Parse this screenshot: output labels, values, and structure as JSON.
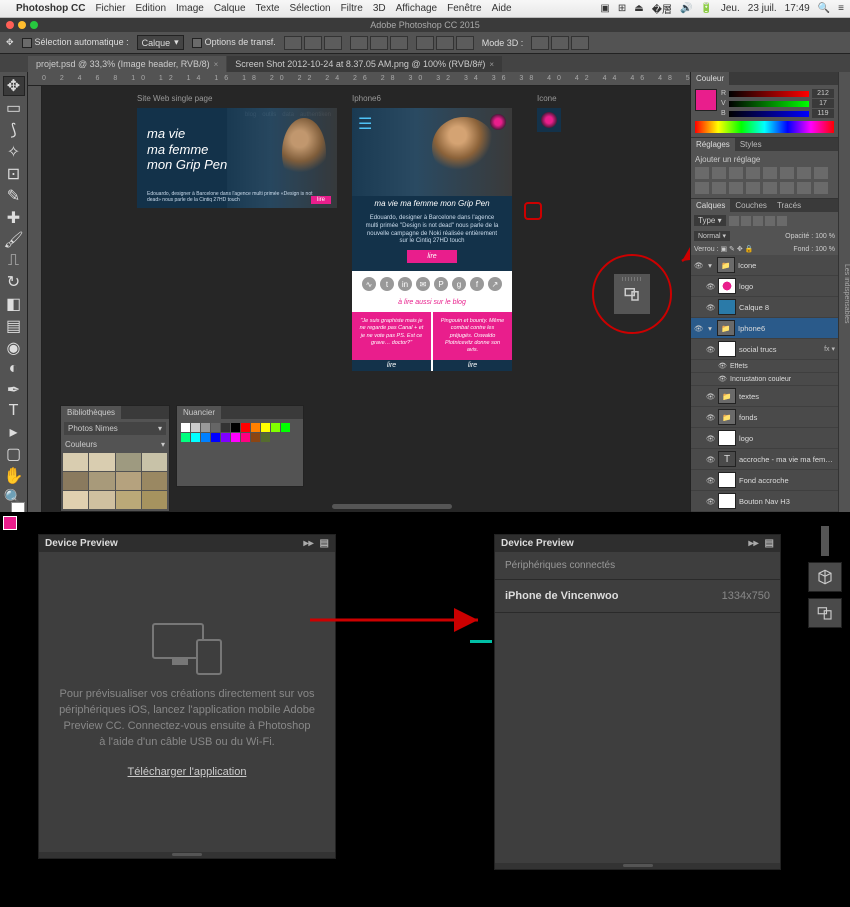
{
  "mac_menu": {
    "app": "Photoshop CC",
    "items": [
      "Fichier",
      "Edition",
      "Image",
      "Calque",
      "Texte",
      "Sélection",
      "Filtre",
      "3D",
      "Affichage",
      "Fenêtre",
      "Aide"
    ],
    "right": {
      "day": "Jeu.",
      "date": "23 juil.",
      "time": "17:49"
    }
  },
  "window_title": "Adobe Photoshop CC 2015",
  "options_bar": {
    "auto_select": "Sélection automatique :",
    "target": "Calque",
    "transform": "Options de transf.",
    "mode3d": "Mode 3D :"
  },
  "tabs": [
    {
      "label": "projet.psd @ 33,3% (Image header, RVB/8)",
      "active": true
    },
    {
      "label": "Screen Shot 2012-10-24 at 8.37.05 AM.png @ 100% (RVB/8#)",
      "active": false
    }
  ],
  "ruler_marks": "0  2  4  6  8  10  12  14  16  18  20  22  24  26  28  30  32  34  36  38  40  42  44  46  48  50  52",
  "artboards": {
    "a1_label": "Site Web single page",
    "a1_nav": [
      "blog",
      "outils",
      "data",
      "authentiken"
    ],
    "a1_h1": "ma vie",
    "a1_h2": "ma femme",
    "a1_h3": "mon Grip Pen",
    "a1_small": "Edouardo, designer à Barcelone dans l'agence multi primée «Design is not dead» nous parle de la Cintiq 27HD touch",
    "a1_cta": "lire",
    "a2_label": "Iphone6",
    "a2_tag": "ma vie ma femme mon Grip Pen",
    "a2_intro": "Edouardo, designer à Barcelone dans l'agence multi primée \"Design is not dead\" nous parle de la nouvelle campagne de Noki réalisée entièrement sur le Cintiq 27HD touch",
    "a2_btn": "lire",
    "a2_blog": "à lire aussi sur le blog",
    "a2_c1": "\"Je suis graphiste mais je ne regarde pas Canal + et je ne vote pas PS. Est ce grave… doctor?\"",
    "a2_c2": "Pingouin et bounty. Même combat contre les préjugés. Oswaldo Plotnicevitz donne son avis.",
    "a2_foot": "lire",
    "a3_label": "Icone"
  },
  "biblio": {
    "tab": "Bibliothèques",
    "selected": "Photos Nimes",
    "section": "Couleurs",
    "swatches": [
      "#d9cdb0",
      "#d9cdb0",
      "#9e9a80",
      "#c8c2a8",
      "#8a7a5e",
      "#a89a7a",
      "#b5a27e",
      "#9a8862",
      "#e0d0b0",
      "#cfc0a0",
      "#bba978",
      "#a6935f"
    ]
  },
  "nuancier": {
    "tab": "Nuancier",
    "colors": [
      "#fff",
      "#ccc",
      "#999",
      "#666",
      "#333",
      "#000",
      "#f00",
      "#ff8000",
      "#ff0",
      "#80ff00",
      "#0f0",
      "#00ff80",
      "#0ff",
      "#0080ff",
      "#00f",
      "#8000ff",
      "#f0f",
      "#ff0080",
      "#8b4513",
      "#556b2f"
    ]
  },
  "right_panels": {
    "collapsed": "Les indispensables",
    "color_tab": "Couleur",
    "rgb": {
      "r": "212",
      "g": "17",
      "b": "119"
    },
    "adjust_tab1": "Réglages",
    "adjust_tab2": "Styles",
    "adjust_text": "Ajouter un réglage",
    "layers_tab1": "Calques",
    "layers_tab2": "Couches",
    "layers_tab3": "Tracés",
    "kind": "Type",
    "blend": "Normal",
    "opacity_l": "Opacité :",
    "opacity_v": "100 %",
    "lock_l": "Verrou :",
    "fill_l": "Fond :",
    "fill_v": "100 %",
    "layers": [
      {
        "name": "Icone",
        "type": "group",
        "open": true
      },
      {
        "name": "logo",
        "type": "pink",
        "indent": 1
      },
      {
        "name": "Calque 8",
        "type": "blue",
        "indent": 1
      },
      {
        "name": "Iphone6",
        "type": "group",
        "open": true,
        "sel": true
      },
      {
        "name": "social trucs",
        "type": "shape",
        "indent": 1,
        "fx": true
      },
      {
        "name": "Effets",
        "type": "fx",
        "indent": 2
      },
      {
        "name": "Incrustation couleur",
        "type": "fx",
        "indent": 2
      },
      {
        "name": "textes",
        "type": "folder",
        "indent": 1
      },
      {
        "name": "fonds",
        "type": "folder",
        "indent": 1
      },
      {
        "name": "logo",
        "type": "shape",
        "indent": 1
      },
      {
        "name": "accroche - ma vie ma femme ...",
        "type": "text",
        "indent": 1
      },
      {
        "name": "Fond accroche",
        "type": "shape",
        "indent": 1
      },
      {
        "name": "Bouton Nav H3",
        "type": "shape",
        "indent": 1
      }
    ]
  },
  "device_preview": {
    "title": "Device Preview",
    "empty_text": "Pour prévisualiser vos créations directement sur vos périphériques iOS, lancez l'application mobile Adobe Preview CC. Connectez-vous ensuite à Photoshop à l'aide d'un câble USB ou du Wi-Fi.",
    "link": "Télécharger l'application",
    "connected_label": "Périphériques connectés",
    "device_name": "iPhone de Vincenwoo",
    "device_res": "1334x750"
  }
}
